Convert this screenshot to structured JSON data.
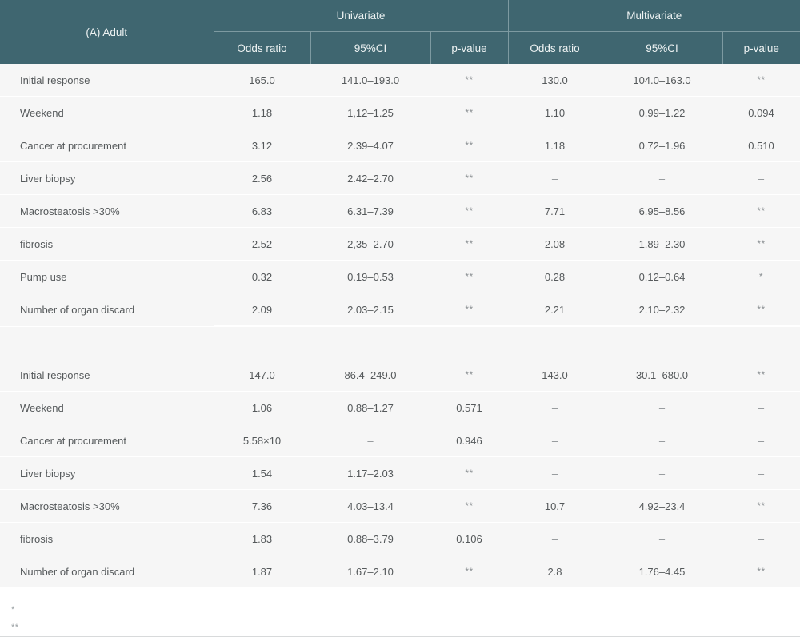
{
  "table": {
    "row_label_header": "(A) Adult",
    "groups": [
      {
        "label": "Univariate"
      },
      {
        "label": "Multivariate"
      }
    ],
    "subheaders": [
      "Odds ratio",
      "95%CI",
      "p-value",
      "Odds ratio",
      "95%CI",
      "p-value"
    ],
    "sections": [
      {
        "rows": [
          {
            "label": "Initial response",
            "u_or": "165.0",
            "u_ci": "141.0–193.0",
            "u_p": "**",
            "m_or": "130.0",
            "m_ci": "104.0–163.0",
            "m_p": "**"
          },
          {
            "label": "Weekend",
            "u_or": "1.18",
            "u_ci": "1,12–1.25",
            "u_p": "**",
            "m_or": "1.10",
            "m_ci": "0.99–1.22",
            "m_p": "0.094"
          },
          {
            "label": "Cancer at procurement",
            "u_or": "3.12",
            "u_ci": "2.39–4.07",
            "u_p": "**",
            "m_or": "1.18",
            "m_ci": "0.72–1.96",
            "m_p": "0.510"
          },
          {
            "label": "Liver biopsy",
            "u_or": "2.56",
            "u_ci": "2.42–2.70",
            "u_p": "**",
            "m_or": "–",
            "m_ci": "–",
            "m_p": "–"
          },
          {
            "label": "Macrosteatosis >30%",
            "u_or": "6.83",
            "u_ci": "6.31–7.39",
            "u_p": "**",
            "m_or": "7.71",
            "m_ci": "6.95–8.56",
            "m_p": "**"
          },
          {
            "label": "fibrosis",
            "u_or": "2.52",
            "u_ci": "2,35–2.70",
            "u_p": "**",
            "m_or": "2.08",
            "m_ci": "1.89–2.30",
            "m_p": "**"
          },
          {
            "label": "Pump use",
            "u_or": "0.32",
            "u_ci": "0.19–0.53",
            "u_p": "**",
            "m_or": "0.28",
            "m_ci": "0.12–0.64",
            "m_p": "*"
          },
          {
            "label": "Number of organ discard",
            "u_or": "2.09",
            "u_ci": "2.03–2.15",
            "u_p": "**",
            "m_or": "2.21",
            "m_ci": "2.10–2.32",
            "m_p": "**"
          }
        ]
      },
      {
        "rows": [
          {
            "label": "Initial response",
            "u_or": "147.0",
            "u_ci": "86.4–249.0",
            "u_p": "**",
            "m_or": "143.0",
            "m_ci": "30.1–680.0",
            "m_p": "**"
          },
          {
            "label": "Weekend",
            "u_or": "1.06",
            "u_ci": "0.88–1.27",
            "u_p": "0.571",
            "m_or": "–",
            "m_ci": "–",
            "m_p": "–"
          },
          {
            "label": "Cancer at procurement",
            "u_or": "5.58×10",
            "u_ci": "–",
            "u_p": "0.946",
            "m_or": "–",
            "m_ci": "–",
            "m_p": "–"
          },
          {
            "label": "Liver biopsy",
            "u_or": "1.54",
            "u_ci": "1.17–2.03",
            "u_p": "**",
            "m_or": "–",
            "m_ci": "–",
            "m_p": "–"
          },
          {
            "label": "Macrosteatosis >30%",
            "u_or": "7.36",
            "u_ci": "4.03–13.4",
            "u_p": "**",
            "m_or": "10.7",
            "m_ci": "4.92–23.4",
            "m_p": "**"
          },
          {
            "label": "fibrosis",
            "u_or": "1.83",
            "u_ci": "0.88–3.79",
            "u_p": "0.106",
            "m_or": "–",
            "m_ci": "–",
            "m_p": "–"
          },
          {
            "label": "Number of organ discard",
            "u_or": "1.87",
            "u_ci": "1.67–2.10",
            "u_p": "**",
            "m_or": "2.8",
            "m_ci": "1.76–4.45",
            "m_p": "**"
          }
        ]
      }
    ]
  },
  "footnotes": [
    "*",
    "**"
  ],
  "colors": {
    "header_bg": "#3f6670",
    "header_text": "#eef3f3",
    "row_bg": "#f6f6f6",
    "row_divider": "#ffffff",
    "body_text": "#55595b",
    "muted_text": "#8b9093"
  }
}
